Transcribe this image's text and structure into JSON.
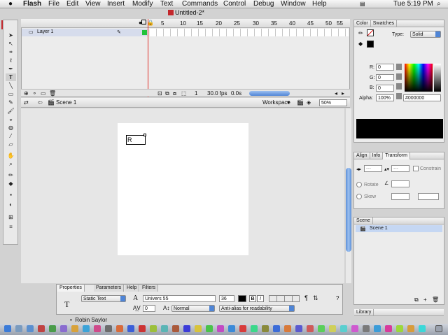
{
  "menubar": {
    "apple": "",
    "items": [
      "Flash",
      "File",
      "Edit",
      "View",
      "Insert",
      "Modify",
      "Text",
      "Commands",
      "Control",
      "Debug",
      "Window",
      "Help"
    ],
    "clock": "Tue 5:19 PM"
  },
  "document": {
    "title": "Untitled-2*"
  },
  "tools": {
    "app_badge": "Fl"
  },
  "timeline": {
    "layer_name": "Layer 1",
    "ruler": [
      "5",
      "10",
      "15",
      "20",
      "25",
      "30",
      "35",
      "40",
      "45",
      "50",
      "55"
    ],
    "current_frame": "1",
    "fps": "30.0 fps",
    "time": "0.0s"
  },
  "editbar": {
    "scene": "Scene 1",
    "workspace": "Workspace",
    "zoom": "50%"
  },
  "stage": {
    "text": "R"
  },
  "properties": {
    "tabs": [
      "Properties",
      "Parameters",
      "Help",
      "Filters"
    ],
    "text_type": "Static Text",
    "font": "Univers 55",
    "size": "36",
    "bold": "B",
    "italic": "I",
    "letter_spacing": "0",
    "position": "Normal",
    "antialias": "Anti-alias for readability"
  },
  "color_panel": {
    "tabs": [
      "Color",
      "Swatches"
    ],
    "type_label": "Type:",
    "type_value": "Solid",
    "r_label": "R:",
    "r": "0",
    "g_label": "G:",
    "g": "0",
    "b_label": "B:",
    "b": "0",
    "alpha_label": "Alpha:",
    "alpha": "100%",
    "hex": "#000000",
    "current_color": "#000000"
  },
  "transform_panel": {
    "tabs": [
      "Align",
      "Info",
      "Transform"
    ],
    "w_placeholder": "---",
    "h_placeholder": "---",
    "constrain": "Constrain",
    "rotate": "Rotate",
    "skew": "Skew"
  },
  "scene_panel": {
    "tab": "Scene",
    "item": "Scene 1"
  },
  "library_panel": {
    "tab": "Library"
  },
  "background_note": "Robin Saylor"
}
